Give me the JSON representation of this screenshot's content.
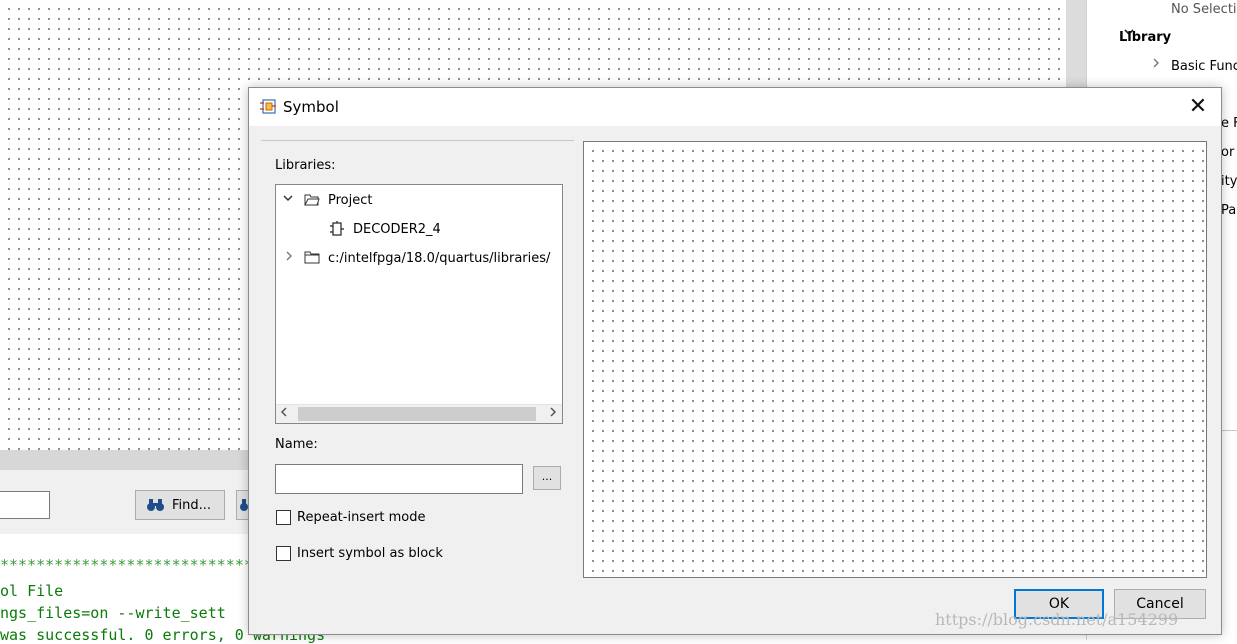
{
  "background": {
    "side_panel": {
      "no_selection": "No Selecti",
      "library_label": "Library",
      "basic_functions": "Basic Func",
      "cut_labels": [
        "e F",
        "or",
        "ity",
        "Pa"
      ]
    },
    "find_button": "Find...",
    "console_lines": [
      "***********************************",
      "ol File",
      "ngs_files=on --write_sett",
      "was successful. 0 errors, 0 warnings"
    ]
  },
  "dialog": {
    "title": "Symbol",
    "close_glyph": "✕",
    "libraries_label": "Libraries:",
    "tree": [
      {
        "label": "Project",
        "expanded": true,
        "icon": "folder-open-icon"
      },
      {
        "label": "DECODER2_4",
        "icon": "symbol-icon"
      },
      {
        "label": "c:/intelfpga/18.0/quartus/libraries/",
        "expanded": false,
        "icon": "folder-icon"
      }
    ],
    "name_label": "Name:",
    "name_value": "",
    "browse_label": "...",
    "repeat_insert_label": "Repeat-insert mode",
    "insert_block_label": "Insert symbol as block",
    "ok_label": "OK",
    "cancel_label": "Cancel"
  },
  "watermark": "https://blog.csdn.net/a154299"
}
